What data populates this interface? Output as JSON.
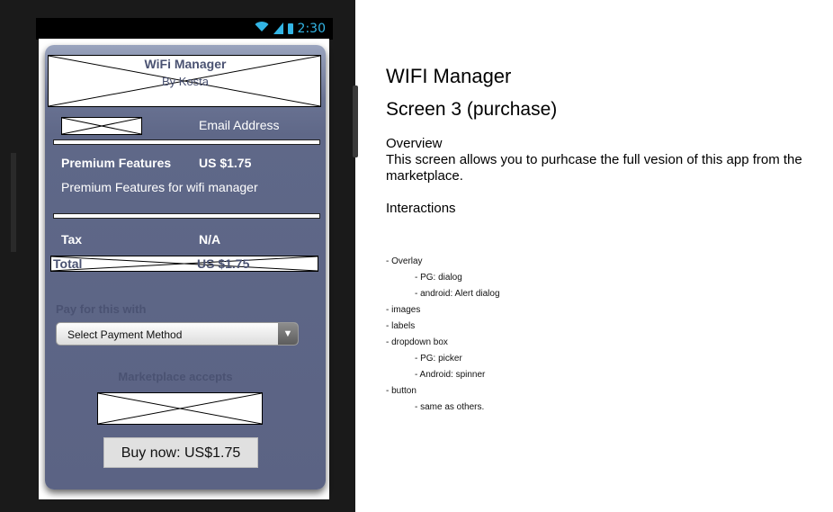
{
  "status_bar": {
    "time": "2:30"
  },
  "dialog": {
    "header_title": "WiFi Manager",
    "header_subtitle": "By Kosta",
    "email_label": "Email Address",
    "feature_name": "Premium Features",
    "feature_price": "US $1.75",
    "feature_desc": "Premium Features for wifi manager",
    "tax_label": "Tax",
    "tax_value": "N/A",
    "total_label": "Total",
    "total_value": "US $1.75",
    "pay_label": "Pay for this with",
    "payment_select": "Select Payment Method",
    "marketplace_label": "Marketplace accepts",
    "buy_button": "Buy now: US$1.75"
  },
  "notes": {
    "title": "WIFI Manager",
    "subtitle": "Screen 3 (purchase)",
    "overview_heading": "Overview",
    "overview_text": "This screen allows you to purhcase the full vesion of this app from the marketplace.",
    "interactions_heading": "Interactions",
    "items": [
      {
        "text": "- Overlay",
        "indent": false
      },
      {
        "text": "- PG: dialog",
        "indent": true
      },
      {
        "text": "- android: Alert dialog",
        "indent": true
      },
      {
        "text": "- images",
        "indent": false
      },
      {
        "text": "- labels",
        "indent": false
      },
      {
        "text": "- dropdown box",
        "indent": false
      },
      {
        "text": "- PG: picker",
        "indent": true
      },
      {
        "text": "- Android: spinner",
        "indent": true
      },
      {
        "text": "- button",
        "indent": false
      },
      {
        "text": "- same as others.",
        "indent": true
      }
    ]
  }
}
